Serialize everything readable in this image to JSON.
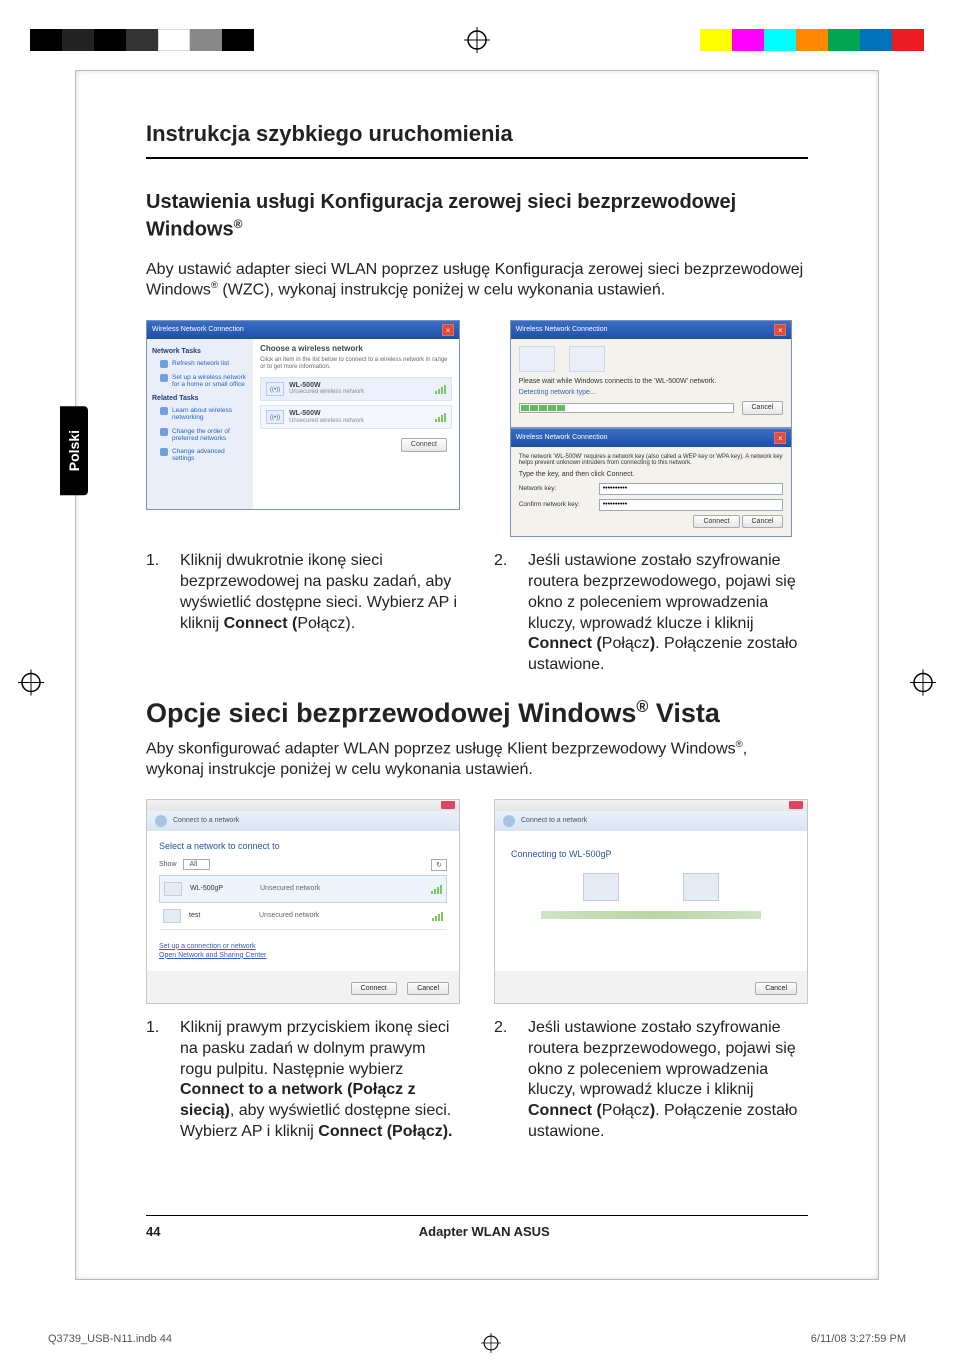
{
  "registration_colors": [
    "#000000",
    "#222222",
    "#000000",
    "#333333",
    "#ffffff",
    "#888888",
    "#000000",
    "#ffff00",
    "#ff00ff",
    "#00ffff",
    "#ff8800",
    "#00a651",
    "#0072bc",
    "#ed1c24"
  ],
  "side_tab": "Polski",
  "doc_header": "Instrukcja szybkiego uruchomienia",
  "section1": {
    "title_pre": "Ustawienia usługi Konfiguracja zerowej sieci bezprzewodowej Windows",
    "title_sup": "®",
    "para_pre": "Aby ustawić adapter sieci WLAN poprzez usługę Konfiguracja zerowej sieci bezprzewodowej Windows",
    "para_sup": "®",
    "para_post": " (WZC), wykonaj instrukcję poniżej w celu wykonania ustawień."
  },
  "xp_list": {
    "title": "Wireless Network Connection",
    "side": {
      "tasks_h": "Network Tasks",
      "refresh": "Refresh network list",
      "setup": "Set up a wireless network for a home or small office",
      "related_h": "Related Tasks",
      "learn": "Learn about wireless networking",
      "order": "Change the order of preferred networks",
      "adv": "Change advanced settings"
    },
    "main": {
      "heading": "Choose a wireless network",
      "desc": "Click an item in the list below to connect to a wireless network in range or to get more information.",
      "net1": {
        "name": "WL-500W",
        "type": "Unsecured wireless network"
      },
      "net2": {
        "name": "WL-500W",
        "type": "Unsecured wireless network"
      },
      "connect": "Connect"
    }
  },
  "xp_right": {
    "dlg1": {
      "title": "Wireless Network Connection",
      "wait": "Please wait while Windows connects to the 'WL-500W' network.",
      "detect": "Detecting network type...",
      "cancel": "Cancel"
    },
    "dlg2": {
      "title": "Wireless Network Connection",
      "desc": "The network 'WL-500W' requires a network key (also called a WEP key or WPA key). A network key helps prevent unknown intruders from connecting to this network.",
      "typekey": "Type the key, and then click Connect.",
      "netkey_l": "Network key:",
      "netkey_v": "••••••••••",
      "confirm_l": "Confirm network key:",
      "confirm_v": "••••••••••",
      "connect": "Connect",
      "cancel": "Cancel"
    }
  },
  "step1_left": {
    "num": "1.",
    "text_pre": "Kliknij dwukrotnie ikonę sieci bezprzewodowej na pasku zadań, aby wyświetlić dostępne sieci. Wybierz AP i kliknij ",
    "bold1": "Connect (",
    "text_post": "Połącz)."
  },
  "step1_right": {
    "num": "2.",
    "text_pre": "Jeśli ustawione zostało szyfrowanie routera bezprzewodowego, pojawi się okno z poleceniem wprowadzenia kluczy, wprowadź klucze i kliknij ",
    "bold1": "Connect (",
    "mid": "Połącz",
    "bold2": ")",
    "text_post": ". Połączenie zostało ustawione."
  },
  "h2": {
    "pre": "Opcje sieci bezprzewodowej Windows",
    "sup": "®",
    "post": " Vista"
  },
  "section2_para": {
    "pre": "Aby skonfigurować adapter WLAN poprzez usługę Klient bezprzewodowy Windows",
    "sup": "®",
    "post": ", wykonaj instrukcje poniżej w celu wykonania ustawień."
  },
  "vista_left": {
    "bread": "Connect to a network",
    "heading": "Select a network to connect to",
    "show_l": "Show",
    "show_v": "All",
    "refresh": "↻",
    "row1": {
      "name": "WL-500gP",
      "type": "Unsecured network"
    },
    "row2": {
      "name": "test",
      "type": "Unsecured network"
    },
    "link1": "Set up a connection or network",
    "link2": "Open Network and Sharing Center",
    "connect": "Connect",
    "cancel": "Cancel"
  },
  "vista_right": {
    "bread": "Connect to a network",
    "heading": "Connecting to WL-500gP",
    "cancel": "Cancel"
  },
  "step2_left": {
    "num": "1.",
    "t1": "Kliknij prawym przyciskiem ikonę sieci na pasku zadań w dolnym prawym rogu pulpitu. Następnie wybierz ",
    "b1": "Connect to a network (Połącz z siecią)",
    "t2": ", aby wyświetlić dostępne sieci. Wybierz AP i kliknij ",
    "b2": "Connect (Połącz)."
  },
  "step2_right": {
    "num": "2.",
    "text_pre": "Jeśli ustawione zostało szyfrowanie routera bezprzewodowego, pojawi się okno z poleceniem wprowadzenia kluczy, wprowadź klucze i kliknij ",
    "bold1": "Connect (",
    "mid": "Połącz",
    "bold2": ")",
    "text_post": ". Połączenie zostało ustawione."
  },
  "footer": {
    "page": "44",
    "title": "Adapter WLAN ASUS"
  },
  "crop": {
    "file": "Q3739_USB-N11.indb   44",
    "stamp": "6/11/08   3:27:59 PM"
  }
}
